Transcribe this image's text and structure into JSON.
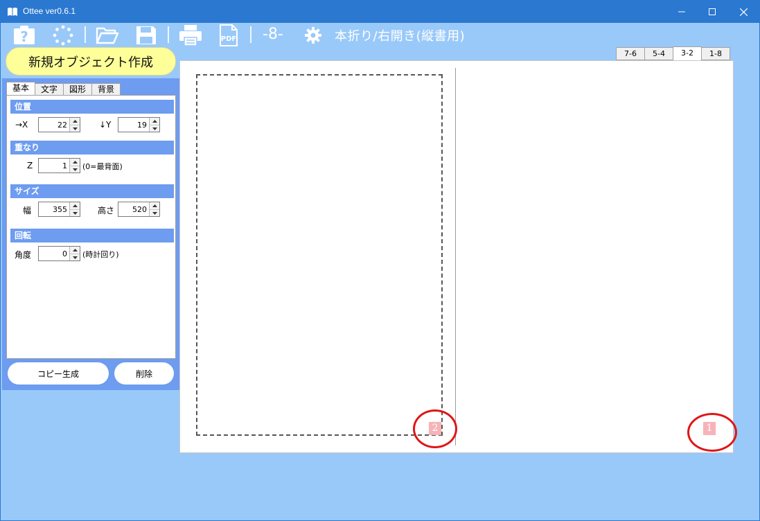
{
  "window": {
    "title": "Ottee ver0.6.1"
  },
  "toolbar": {
    "page_indicator": "-8-",
    "layout_mode": "本折り/右開き(縦書用)",
    "icons": [
      "help-icon",
      "loading-icon",
      "open-folder-icon",
      "save-icon",
      "print-icon",
      "pdf-icon",
      "settings-icon"
    ],
    "pdf_label": "PDF"
  },
  "new_object_button": "新規オブジェクト作成",
  "tabs": [
    "基本",
    "文字",
    "図形",
    "背景"
  ],
  "properties": {
    "position": {
      "heading": "位置",
      "x_label": "→X",
      "x_value": "22",
      "y_label": "↓Y",
      "y_value": "19"
    },
    "layer": {
      "heading": "重なり",
      "z_label": "Z",
      "z_value": "1",
      "z_note": "(0=最背面)"
    },
    "size": {
      "heading": "サイズ",
      "width_label": "幅",
      "width_value": "355",
      "height_label": "高さ",
      "height_value": "520"
    },
    "rotation": {
      "heading": "回転",
      "angle_label": "角度",
      "angle_value": "0",
      "angle_note": "(時計回り)"
    }
  },
  "actions": {
    "copy": "コピー生成",
    "delete": "削除"
  },
  "page_tabs": [
    "7-6",
    "5-4",
    "3-2",
    "1-8"
  ],
  "active_page_tab": "3-2",
  "canvas": {
    "left_page_number": "2",
    "right_page_number": "1"
  },
  "colors": {
    "title_bar": "#2b78d0",
    "background": "#99c9f9",
    "panel": "#6d9cf0",
    "new_button": "#ffff99",
    "page_badge": "#f7b3b7",
    "highlight_ring": "#e01515"
  }
}
